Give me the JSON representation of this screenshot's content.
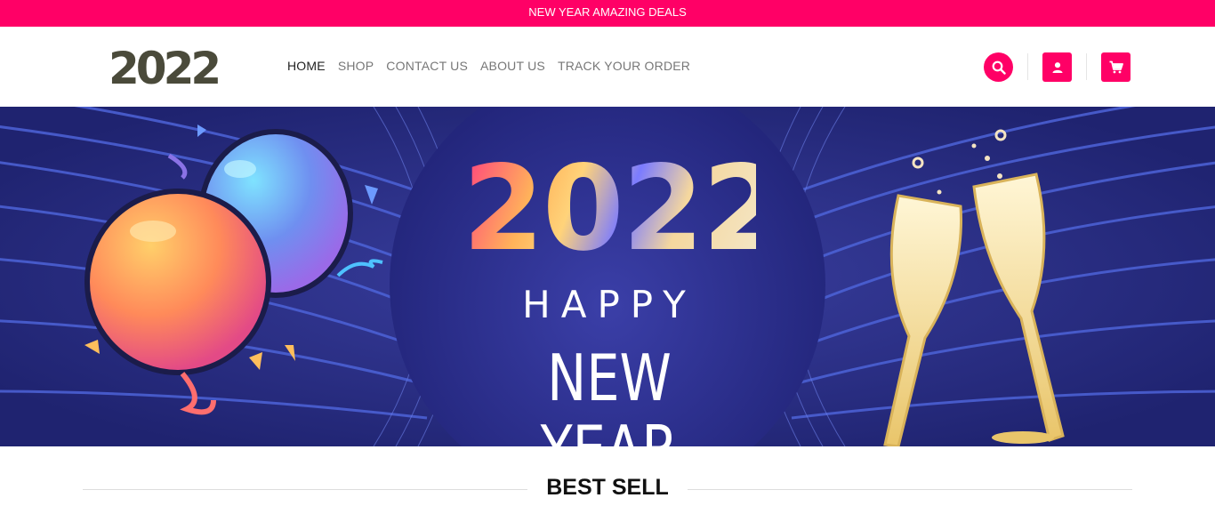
{
  "topbar": {
    "text": "NEW YEAR AMAZING DEALS"
  },
  "logo": {
    "text": "2022"
  },
  "nav": [
    {
      "label": "HOME",
      "active": true
    },
    {
      "label": "SHOP"
    },
    {
      "label": "CONTACT US"
    },
    {
      "label": "ABOUT US"
    },
    {
      "label": "TRACK YOUR ORDER"
    }
  ],
  "icons": {
    "search": "search-icon",
    "account": "user-icon",
    "cart": "cart-icon"
  },
  "banner": {
    "year": "2022",
    "line1": "HAPPY",
    "line2": "NEW YEAR"
  },
  "section": {
    "title": "BEST SELL"
  },
  "colors": {
    "accent": "#ff0066",
    "banner_bg": "#23277a"
  }
}
